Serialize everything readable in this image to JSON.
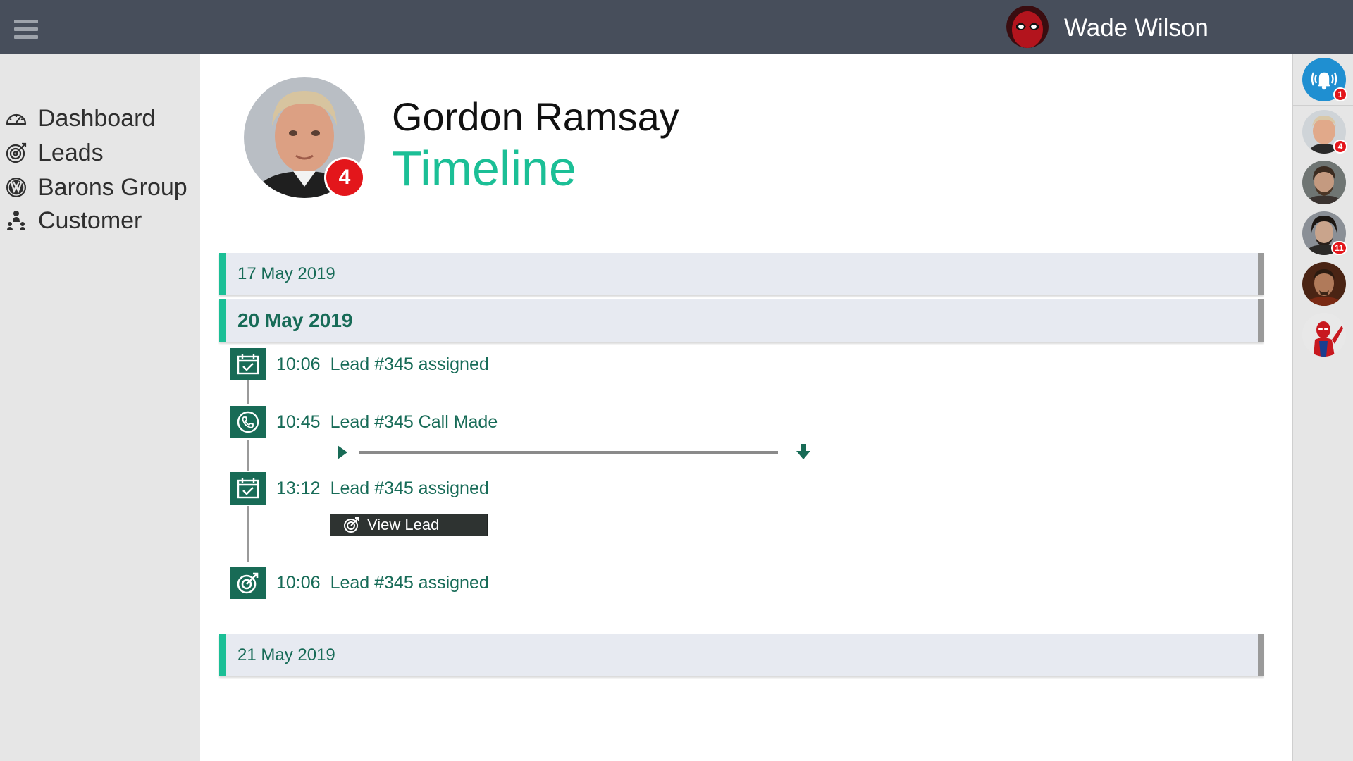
{
  "header": {
    "user_name": "Wade Wilson",
    "user_avatar": "deadpool-avatar"
  },
  "sidebar": {
    "items": [
      {
        "label": "Dashboard",
        "icon": "speedometer-icon"
      },
      {
        "label": "Leads",
        "icon": "target-icon"
      },
      {
        "label": "Barons Group",
        "icon": "vw-logo-icon"
      },
      {
        "label": "Customer",
        "icon": "people-icon"
      }
    ]
  },
  "rail": {
    "bell_badge": "1",
    "contacts": [
      {
        "avatar": "gordon-ramsay-avatar",
        "badge": "4"
      },
      {
        "avatar": "ned-stark-avatar",
        "badge": ""
      },
      {
        "avatar": "jon-snow-avatar",
        "badge": "11"
      },
      {
        "avatar": "iron-man-avatar",
        "badge": ""
      },
      {
        "avatar": "spider-man-avatar",
        "badge": ""
      }
    ]
  },
  "profile": {
    "name": "Gordon Ramsay",
    "subtitle": "Timeline",
    "badge": "4"
  },
  "timeline": {
    "dates": [
      "17 May 2019",
      "20 May 2019",
      "21 May 2019"
    ],
    "events": [
      {
        "time": "10:06",
        "text": "Lead #345 assigned",
        "icon": "calendar-check-icon"
      },
      {
        "time": "10:45",
        "text": "Lead #345 Call Made",
        "icon": "phone-icon"
      },
      {
        "time": "13:12",
        "text": "Lead #345 assigned",
        "icon": "calendar-check-icon"
      },
      {
        "time": "10:06",
        "text": "Lead #345 assigned",
        "icon": "target-icon"
      }
    ],
    "view_lead_label": "View Lead"
  },
  "colors": {
    "topbar": "#474e5b",
    "accent": "#1bbf96",
    "dark_green": "#186b56",
    "badge_red": "#e3161b",
    "bell_blue": "#1f8fd1"
  }
}
